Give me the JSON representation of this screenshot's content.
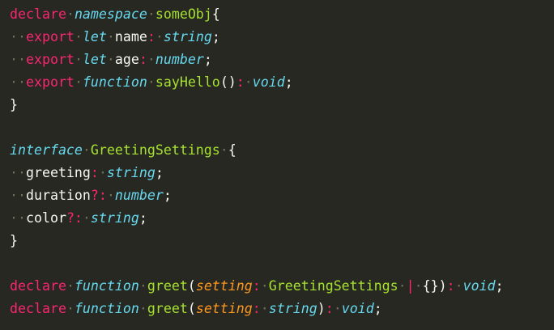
{
  "colors": {
    "background": "#272822",
    "keyword": "#f92672",
    "storage_type": "#66d9ef",
    "entity": "#a6e22e",
    "parameter": "#fd971f",
    "plain": "#f8f8f2",
    "whitespace_marker": "#6f705e"
  },
  "code": {
    "lines": [
      [
        {
          "t": "declare",
          "c": "kw"
        },
        {
          "t": "·",
          "c": "ws"
        },
        {
          "t": "namespace",
          "c": "type"
        },
        {
          "t": "·",
          "c": "ws"
        },
        {
          "t": "someObj",
          "c": "ent"
        },
        {
          "t": "{",
          "c": "id"
        }
      ],
      [
        {
          "t": "··",
          "c": "ws"
        },
        {
          "t": "export",
          "c": "kw"
        },
        {
          "t": "·",
          "c": "ws"
        },
        {
          "t": "let",
          "c": "type"
        },
        {
          "t": "·",
          "c": "ws"
        },
        {
          "t": "name",
          "c": "id"
        },
        {
          "t": ":",
          "c": "kw"
        },
        {
          "t": "·",
          "c": "ws"
        },
        {
          "t": "string",
          "c": "type"
        },
        {
          "t": ";",
          "c": "id"
        }
      ],
      [
        {
          "t": "··",
          "c": "ws"
        },
        {
          "t": "export",
          "c": "kw"
        },
        {
          "t": "·",
          "c": "ws"
        },
        {
          "t": "let",
          "c": "type"
        },
        {
          "t": "·",
          "c": "ws"
        },
        {
          "t": "age",
          "c": "id"
        },
        {
          "t": ":",
          "c": "kw"
        },
        {
          "t": "·",
          "c": "ws"
        },
        {
          "t": "number",
          "c": "type"
        },
        {
          "t": ";",
          "c": "id"
        }
      ],
      [
        {
          "t": "··",
          "c": "ws"
        },
        {
          "t": "export",
          "c": "kw"
        },
        {
          "t": "·",
          "c": "ws"
        },
        {
          "t": "function",
          "c": "type"
        },
        {
          "t": "·",
          "c": "ws"
        },
        {
          "t": "sayHello",
          "c": "ent"
        },
        {
          "t": "()",
          "c": "id"
        },
        {
          "t": ":",
          "c": "kw"
        },
        {
          "t": "·",
          "c": "ws"
        },
        {
          "t": "void",
          "c": "type"
        },
        {
          "t": ";",
          "c": "id"
        }
      ],
      [
        {
          "t": "}",
          "c": "id"
        }
      ],
      [],
      [
        {
          "t": "interface",
          "c": "type"
        },
        {
          "t": "·",
          "c": "ws"
        },
        {
          "t": "GreetingSettings",
          "c": "ent"
        },
        {
          "t": "·",
          "c": "ws"
        },
        {
          "t": "{",
          "c": "id"
        }
      ],
      [
        {
          "t": "··",
          "c": "ws"
        },
        {
          "t": "greeting",
          "c": "id"
        },
        {
          "t": ":",
          "c": "kw"
        },
        {
          "t": "·",
          "c": "ws"
        },
        {
          "t": "string",
          "c": "type"
        },
        {
          "t": ";",
          "c": "id"
        }
      ],
      [
        {
          "t": "··",
          "c": "ws"
        },
        {
          "t": "duration",
          "c": "id"
        },
        {
          "t": "?:",
          "c": "kw"
        },
        {
          "t": "·",
          "c": "ws"
        },
        {
          "t": "number",
          "c": "type"
        },
        {
          "t": ";",
          "c": "id"
        }
      ],
      [
        {
          "t": "··",
          "c": "ws"
        },
        {
          "t": "color",
          "c": "id"
        },
        {
          "t": "?:",
          "c": "kw"
        },
        {
          "t": "·",
          "c": "ws"
        },
        {
          "t": "string",
          "c": "type"
        },
        {
          "t": ";",
          "c": "id"
        }
      ],
      [
        {
          "t": "}",
          "c": "id"
        }
      ],
      [],
      [
        {
          "t": "declare",
          "c": "kw"
        },
        {
          "t": "·",
          "c": "ws"
        },
        {
          "t": "function",
          "c": "type"
        },
        {
          "t": "·",
          "c": "ws"
        },
        {
          "t": "greet",
          "c": "ent"
        },
        {
          "t": "(",
          "c": "id"
        },
        {
          "t": "setting",
          "c": "param"
        },
        {
          "t": ":",
          "c": "kw"
        },
        {
          "t": "·",
          "c": "ws"
        },
        {
          "t": "GreetingSettings",
          "c": "ent"
        },
        {
          "t": "·",
          "c": "ws"
        },
        {
          "t": "|",
          "c": "kw"
        },
        {
          "t": "·",
          "c": "ws"
        },
        {
          "t": "{})",
          "c": "id"
        },
        {
          "t": ":",
          "c": "kw"
        },
        {
          "t": "·",
          "c": "ws"
        },
        {
          "t": "void",
          "c": "type"
        },
        {
          "t": ";",
          "c": "id"
        }
      ],
      [
        {
          "t": "declare",
          "c": "kw"
        },
        {
          "t": "·",
          "c": "ws"
        },
        {
          "t": "function",
          "c": "type"
        },
        {
          "t": "·",
          "c": "ws"
        },
        {
          "t": "greet",
          "c": "ent"
        },
        {
          "t": "(",
          "c": "id"
        },
        {
          "t": "setting",
          "c": "param"
        },
        {
          "t": ":",
          "c": "kw"
        },
        {
          "t": "·",
          "c": "ws"
        },
        {
          "t": "string",
          "c": "type"
        },
        {
          "t": ")",
          "c": "id"
        },
        {
          "t": ":",
          "c": "kw"
        },
        {
          "t": "·",
          "c": "ws"
        },
        {
          "t": "void",
          "c": "type"
        },
        {
          "t": ";",
          "c": "id"
        }
      ]
    ]
  }
}
